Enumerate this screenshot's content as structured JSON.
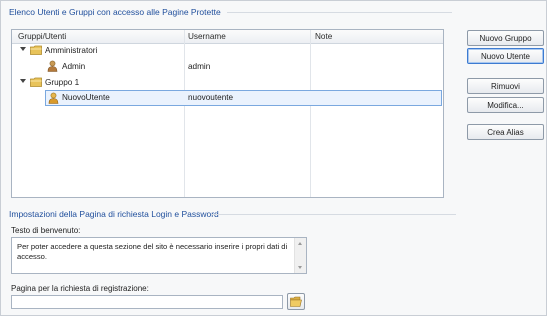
{
  "users_section": {
    "title": "Elenco Utenti e Gruppi con accesso alle Pagine Protette",
    "columns": [
      "Gruppi/Utenti",
      "Username",
      "Note"
    ],
    "rows": [
      {
        "type": "group",
        "name": "Amministratori",
        "username": "",
        "note": ""
      },
      {
        "type": "user",
        "name": "Admin",
        "username": "admin",
        "note": ""
      },
      {
        "type": "group",
        "name": "Gruppo 1",
        "username": "",
        "note": ""
      },
      {
        "type": "user",
        "name": "NuovoUtente",
        "username": "nuovoutente",
        "note": "",
        "selected": true
      }
    ]
  },
  "buttons": {
    "new_group": "Nuovo Gruppo",
    "new_user": "Nuovo Utente",
    "remove": "Rimuovi",
    "edit": "Modifica...",
    "create_alias": "Crea Alias"
  },
  "login_section": {
    "title": "Impostazioni della Pagina di richiesta Login e Password",
    "welcome_label": "Testo di benvenuto:",
    "welcome_text": "Per poter accedere a questa sezione del sito è necessario inserire i propri dati di accesso.",
    "registration_label": "Pagina per la richiesta di registrazione:",
    "registration_value": ""
  },
  "colors": {
    "section_title": "#1f4e9c",
    "selection_bg": "#eaf2fd",
    "selection_border": "#7aa8df",
    "folder": "#e8c35a"
  },
  "icons": {
    "group": "folder-icon",
    "user": "user-icon",
    "browse": "folder-open-icon"
  }
}
